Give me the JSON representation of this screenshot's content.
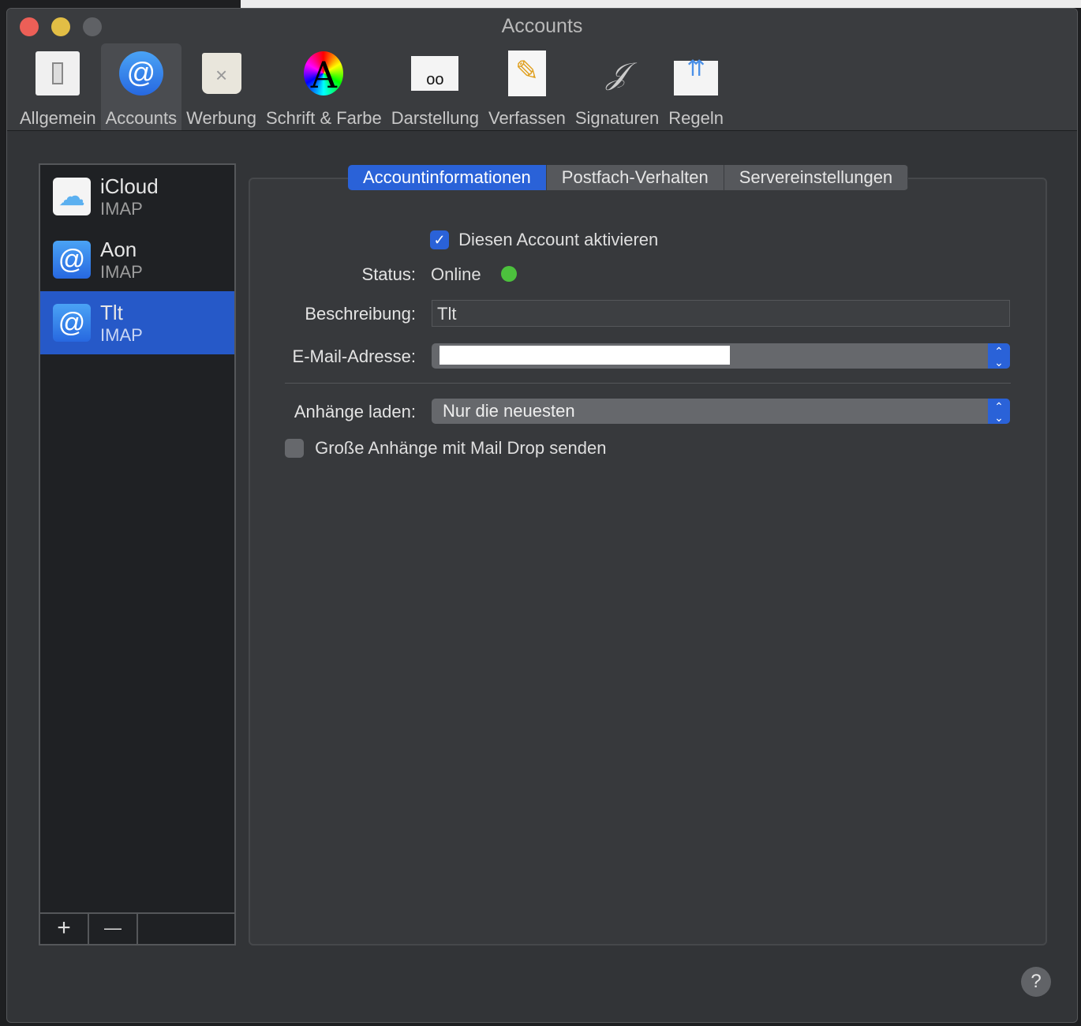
{
  "window": {
    "title": "Accounts"
  },
  "toolbar": [
    {
      "label": "Allgemein"
    },
    {
      "label": "Accounts"
    },
    {
      "label": "Werbung"
    },
    {
      "label": "Schrift & Farbe"
    },
    {
      "label": "Darstellung"
    },
    {
      "label": "Verfassen"
    },
    {
      "label": "Signaturen"
    },
    {
      "label": "Regeln"
    }
  ],
  "accounts": [
    {
      "name": "iCloud",
      "type": "IMAP"
    },
    {
      "name": "Aon",
      "type": "IMAP"
    },
    {
      "name": "Tlt",
      "type": "IMAP"
    }
  ],
  "sidebar_buttons": {
    "add": "+",
    "remove": "—"
  },
  "tabs": [
    "Accountinformationen",
    "Postfach-Verhalten",
    "Servereinstellungen"
  ],
  "form": {
    "enable_label": "Diesen Account aktivieren",
    "enabled": true,
    "status_label": "Status:",
    "status_value": "Online",
    "status_color": "#4cc13d",
    "description_label": "Beschreibung:",
    "description_value": "Tlt",
    "email_label": "E-Mail-Adresse:",
    "attachments_label": "Anhänge laden:",
    "attachments_value": "Nur die neuesten",
    "maildrop_label": "Große Anhänge mit Mail Drop senden",
    "maildrop": false
  },
  "help": "?"
}
